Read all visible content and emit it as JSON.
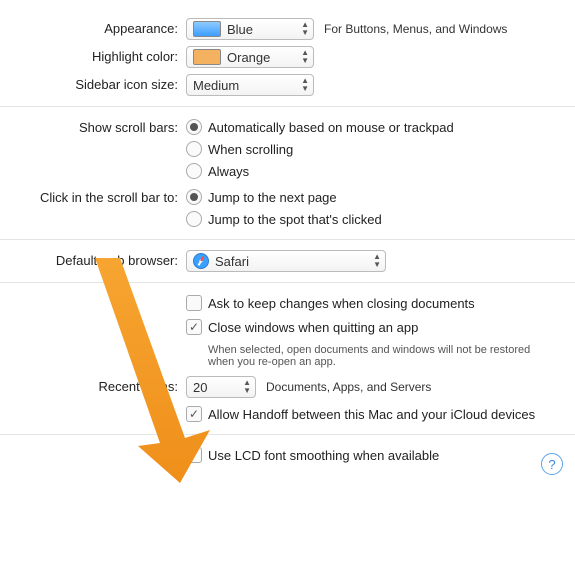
{
  "labels": {
    "appearance": "Appearance:",
    "highlight": "Highlight color:",
    "sidebar": "Sidebar icon size:",
    "scrollbars": "Show scroll bars:",
    "clickscroll": "Click in the scroll bar to:",
    "browser": "Default web browser:",
    "recent": "Recent items:"
  },
  "appearance": {
    "value": "Blue",
    "hint": "For Buttons, Menus, and Windows"
  },
  "highlight": {
    "value": "Orange"
  },
  "sidebar": {
    "value": "Medium"
  },
  "scrollbars": {
    "options": [
      "Automatically based on mouse or trackpad",
      "When scrolling",
      "Always"
    ],
    "selected": 0
  },
  "clickscroll": {
    "options": [
      "Jump to the next page",
      "Jump to the spot that's clicked"
    ],
    "selected": 0
  },
  "browser": {
    "value": "Safari"
  },
  "checks": {
    "ask": {
      "label": "Ask to keep changes when closing documents",
      "checked": false
    },
    "close": {
      "label": "Close windows when quitting an app",
      "checked": true,
      "sub": "When selected, open documents and windows will not be restored when you re-open an app."
    },
    "handoff": {
      "label": "Allow Handoff between this Mac and your iCloud devices",
      "checked": true
    },
    "lcd": {
      "label": "Use LCD font smoothing when available",
      "checked": true
    }
  },
  "recent": {
    "value": "20",
    "hint": "Documents, Apps, and Servers"
  },
  "help": "?"
}
